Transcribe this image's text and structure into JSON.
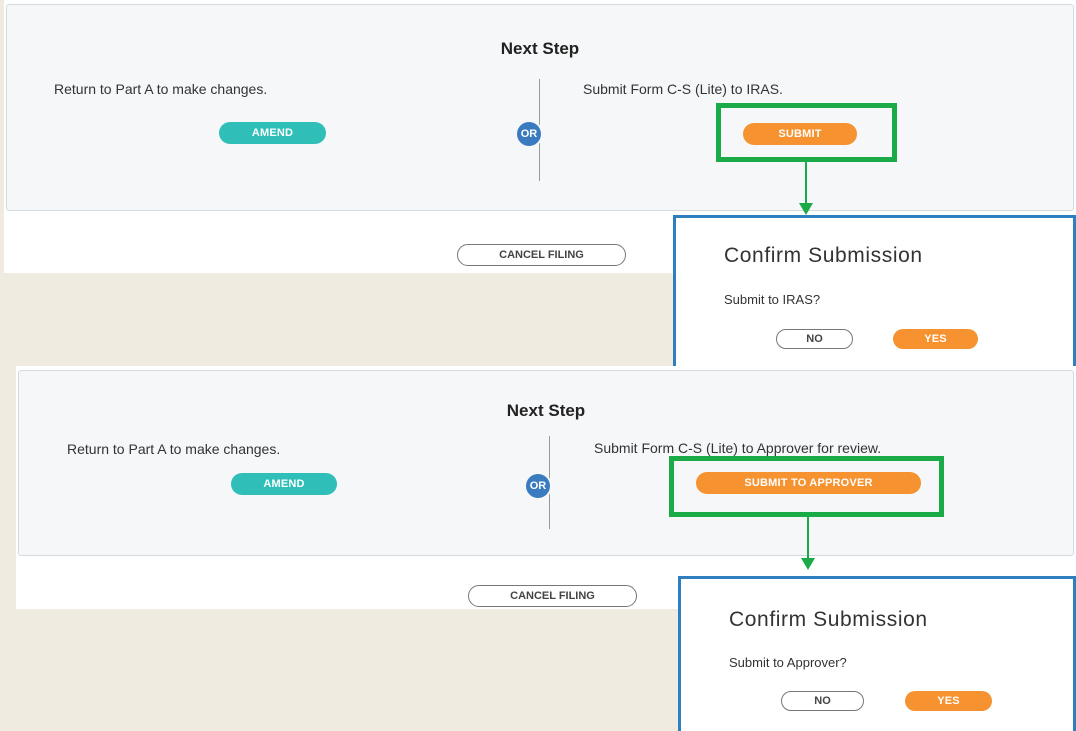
{
  "top": {
    "title": "Next Step",
    "left_text": "Return to Part A to make changes.",
    "amend_label": "AMEND",
    "or_label": "OR",
    "right_text": "Submit Form C-S (Lite) to IRAS.",
    "submit_label": "SUBMIT",
    "cancel_label": "CANCEL FILING",
    "dialog": {
      "title": "Confirm Submission",
      "question": "Submit to IRAS?",
      "no_label": "NO",
      "yes_label": "YES"
    }
  },
  "bottom": {
    "title": "Next Step",
    "left_text": "Return to Part A to make changes.",
    "amend_label": "AMEND",
    "or_label": "OR",
    "right_text": "Submit Form C-S (Lite) to Approver for review.",
    "submit_label": "SUBMIT TO APPROVER",
    "cancel_label": "CANCEL FILING",
    "dialog": {
      "title": "Confirm Submission",
      "question": "Submit to Approver?",
      "no_label": "NO",
      "yes_label": "YES"
    }
  },
  "colors": {
    "teal": "#2fbfb8",
    "orange": "#f6922f",
    "or_blue": "#3a7bbf",
    "highlight_green": "#1aaa48",
    "modal_border": "#2e7fc0"
  }
}
